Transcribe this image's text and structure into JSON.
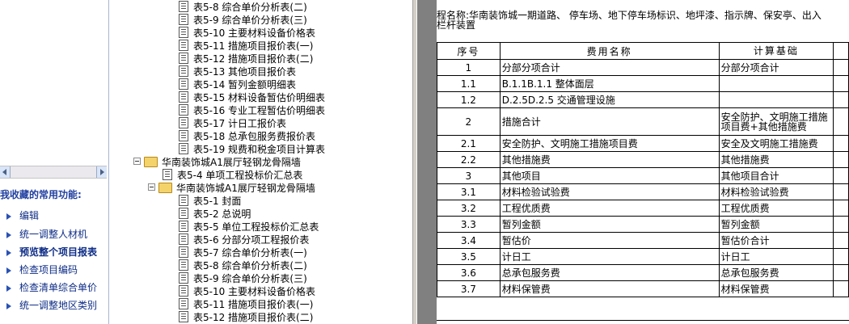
{
  "left_panel": {
    "title": "我收藏的常用功能:",
    "tasks": [
      "编辑",
      "统一调整人材机",
      "预览整个项目报表",
      "检查项目编码",
      "检查清单综合单价",
      "统一调整地区类别"
    ]
  },
  "tree": {
    "items": [
      {
        "type": "doc",
        "label": "表5-8 综合单价分析表(二)"
      },
      {
        "type": "doc",
        "label": "表5-9 综合单价分析表(三)"
      },
      {
        "type": "doc",
        "label": "表5-10 主要材料设备价格表"
      },
      {
        "type": "doc",
        "label": "表5-11 措施项目报价表(一)"
      },
      {
        "type": "doc",
        "label": "表5-12 措施项目报价表(二)"
      },
      {
        "type": "doc",
        "label": "表5-13 其他项目报价表"
      },
      {
        "type": "doc",
        "label": "表5-14 暂列金额明细表"
      },
      {
        "type": "doc",
        "label": "表5-15 材料设备暂估价明细表"
      },
      {
        "type": "doc",
        "label": "表5-16 专业工程暂估价明细表"
      },
      {
        "type": "doc",
        "label": "表5-17 计日工报价表"
      },
      {
        "type": "doc",
        "label": "表5-18 总承包服务费报价表"
      },
      {
        "type": "doc",
        "label": "表5-19 规费和税金项目计算表"
      },
      {
        "type": "folder",
        "label": "华南装饰城A1展厅轻钢龙骨隔墙"
      },
      {
        "type": "doc",
        "label": "表5-4 单项工程投标价汇总表"
      },
      {
        "type": "folder",
        "label": "华南装饰城A1展厅轻钢龙骨隔墙"
      },
      {
        "type": "doc",
        "label": "表5-1 封面"
      },
      {
        "type": "doc",
        "label": "表5-2 总说明"
      },
      {
        "type": "doc",
        "label": "表5-5 单位工程投标价汇总表"
      },
      {
        "type": "doc",
        "label": "表5-6 分部分项工程报价表"
      },
      {
        "type": "doc",
        "label": "表5-7 综合单价分析表(一)"
      },
      {
        "type": "doc",
        "label": "表5-8 综合单价分析表(二)"
      },
      {
        "type": "doc",
        "label": "表5-9 综合单价分析表(三)"
      },
      {
        "type": "doc",
        "label": "表5-10 主要材料设备价格表"
      },
      {
        "type": "doc",
        "label": "表5-11 措施项目报价表(一)"
      },
      {
        "type": "doc",
        "label": "表5-12 措施项目报价表(二)"
      }
    ]
  },
  "report": {
    "project_line1": "程名称:华南装饰城一期道路、 停车场、地下停车场标识、地坪漆、指示牌、保安亭、出入",
    "project_line2": "栏杆装置",
    "headers": [
      "序号",
      "费用名称",
      "计算基础"
    ],
    "rows": [
      {
        "no": "1",
        "name": "分部分项合计",
        "basis": "分部分项合计"
      },
      {
        "no": "1.1",
        "name": "B.1.1B.1.1 整体面层",
        "basis": ""
      },
      {
        "no": "1.2",
        "name": "D.2.5D.2.5 交通管理设施",
        "basis": ""
      },
      {
        "no": "2",
        "name": "措施合计",
        "basis": "安全防护、文明施工措施项目费+其他措施费"
      },
      {
        "no": "2.1",
        "name": "安全防护、文明施工措施项目费",
        "basis": "安全及文明施工措施费"
      },
      {
        "no": "2.2",
        "name": "其他措施费",
        "basis": "其他措施费"
      },
      {
        "no": "3",
        "name": "其他项目",
        "basis": "其他项目合计"
      },
      {
        "no": "3.1",
        "name": "材料检验试验费",
        "basis": "材料检验试验费"
      },
      {
        "no": "3.2",
        "name": "工程优质费",
        "basis": "工程优质费"
      },
      {
        "no": "3.3",
        "name": "暂列金额",
        "basis": "暂列金额"
      },
      {
        "no": "3.4",
        "name": "暂估价",
        "basis": "暂估价合计"
      },
      {
        "no": "3.5",
        "name": "计日工",
        "basis": "计日工"
      },
      {
        "no": "3.6",
        "name": "总承包服务费",
        "basis": "总承包服务费"
      },
      {
        "no": "3.7",
        "name": "材料保管费",
        "basis": "材料保管费"
      }
    ]
  }
}
